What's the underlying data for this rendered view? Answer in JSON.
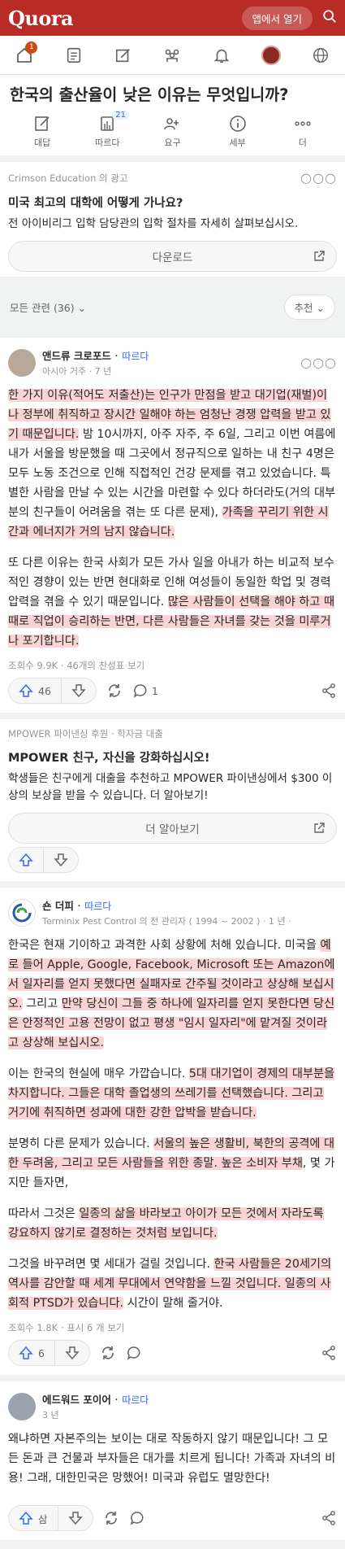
{
  "header": {
    "logo": "Quora",
    "open_app": "앱에서 열기"
  },
  "nav": {
    "notification_count": "1"
  },
  "question": {
    "title": "한국의 출산율이 낮은 이유는 무엇입니까?"
  },
  "actions": [
    {
      "label": "대답"
    },
    {
      "label": "따르다",
      "count": "21"
    },
    {
      "label": "요구"
    },
    {
      "label": "세부"
    },
    {
      "label": "더"
    }
  ],
  "ad1": {
    "sponsor": "Crimson Education 의 광고",
    "title": "미국 최고의 대학에 어떻게 가나요?",
    "text": "전 아이비리그 입학 담당관의 입학 절차를 자세히 살펴보십시오.",
    "cta": "다운로드"
  },
  "filter": {
    "label": "모든 관련 (36)",
    "sort": "추천"
  },
  "answer1": {
    "name": "앤드류 크로포드",
    "follow": "따르다",
    "cred": "아시아 거주 · 7 년",
    "p1_hl1": "한 가지 이유(적어도 저출산)는 인구가 만점을 받고 대기업(재벌)이나 정부에 취직하고 장시간 일해야 하는 엄청난 경쟁 압력을 받고 있기 때문입니다.",
    "p1_mid": " 밤 10시까지, 아주 자주, 주 6일, 그리고 이번 여름에 내가 서울을 방문했을 때 그곳에서 정규직으로 일하는 내 친구 4명은 모두 노동 조건으로 인해 직접적인 건강 문제를 겪고 있었습니다. 특별한 사람을 만날 수 있는 시간을 마련할 수 있다 하더라도(거의 대부분의 친구들이 어려움을 겪는 또 다른 문제), ",
    "p1_hl2": "가족을 꾸리기 위한 시간과 에너지가 거의 남지 않습니다.",
    "p2_text": "또 다른 이유는 한국 사회가 모든 가사 일을 아내가 하는 비교적 보수적인 경향이 있는 반면 현대화로 인해 여성들이 동일한 학업 및 경력 압력을 겪을 수 있기 때문입니다. ",
    "p2_hl": "많은 사람들이 선택을 해야 하고 때때로 직업이 승리하는 반면, 다른 사람들은 자녀를 갖는 것을 미루거나 포기합니다.",
    "stats": "조회수 9.9K · 46개의 찬성표 보기",
    "upvotes": "46",
    "comments": "1"
  },
  "ad2": {
    "sponsor": "MPOWER 파이낸싱 후원 · 학자금 대출",
    "title": "MPOWER 친구, 자신을 강화하십시오!",
    "text": "학생들은 친구에게 대출을 추천하고 MPOWER 파이낸싱에서 $300 이상의 보상을 받을 수 있습니다. 더 알아보기!",
    "cta": "더 알아보기"
  },
  "answer2": {
    "name": "숀 더피",
    "follow": "따르다",
    "cred": "Terminix Pest Control 의 전 관리자 ( 1994 ~ 2002 ) · 1 년 ·",
    "p1_a": "한국은 현재 기이하고 과격한 사회 상황에 처해 있습니다. 미국을 ",
    "p1_hl1": "예로 들어 Apple, Google, Facebook, Microsoft 또는 Amazon에서 일자리를 얻지 못했다면 실패자로 간주될 것이라고 상상해 보십시오.",
    "p1_b": " 그리고 ",
    "p1_hl2": "만약 당신이 그들 중 하나에 일자리를 얻지 못한다면 당신은 안정적인 고용 전망이 없고 평생 \"임시 일자리\"에 맡겨질 것이라고 상상해 보십시오.",
    "p2_a": "이는 한국의 현실에 매우 가깝습니다. ",
    "p2_hl": "5대 대기업이 경제의 대부분을 차지합니다. 그들은 대학 졸업생의 쓰레기를 선택했습니다. 그리고 거기에 취직하면 성과에 대한 강한 압박을 받습니다.",
    "p3_a": "분명히 다른 문제가 있습니다. ",
    "p3_hl": "서울의 높은 생활비, 북한의 공격에 대한 두려움, 그리고 모든 사람들을 위한 종말. 높은 소비자 부채",
    "p3_b": ", 몇 가지만 들자면,",
    "p4_a": "따라서 그것은 ",
    "p4_hl": "일종의 삶을 바라보고 아이가 모든 것에서 자라도록 강요하지 않기로 결정하는 것처럼 보입니다.",
    "p5_a": "그것을 바꾸려면 몇 세대가 걸릴 것입니다. ",
    "p5_hl": "한국 사람들은 20세기의 역사를 감안할 때 세계 무대에서 연약함을 느낄 것입니다. 일종의 사회적 PTSD가 있습니다.",
    "p5_b": " 시간이 말해 줄거야.",
    "stats": "조회수 1.8K · 표시 6 개 보기",
    "upvotes": "6"
  },
  "answer3": {
    "name": "에드워드 포이어",
    "follow": "따르다",
    "cred": "3 년",
    "p1": "왜냐하면 자본주의는 보이는 대로 작동하지 않기 때문입니다! 그 모든 돈과 큰 건물과 부자들은 대가를 치르게 됩니다! 가족과 자녀의 비용! 그래, 대한민국은 망했어! 미국과 유럽도 멸망한다!",
    "upvotes": "삼"
  }
}
